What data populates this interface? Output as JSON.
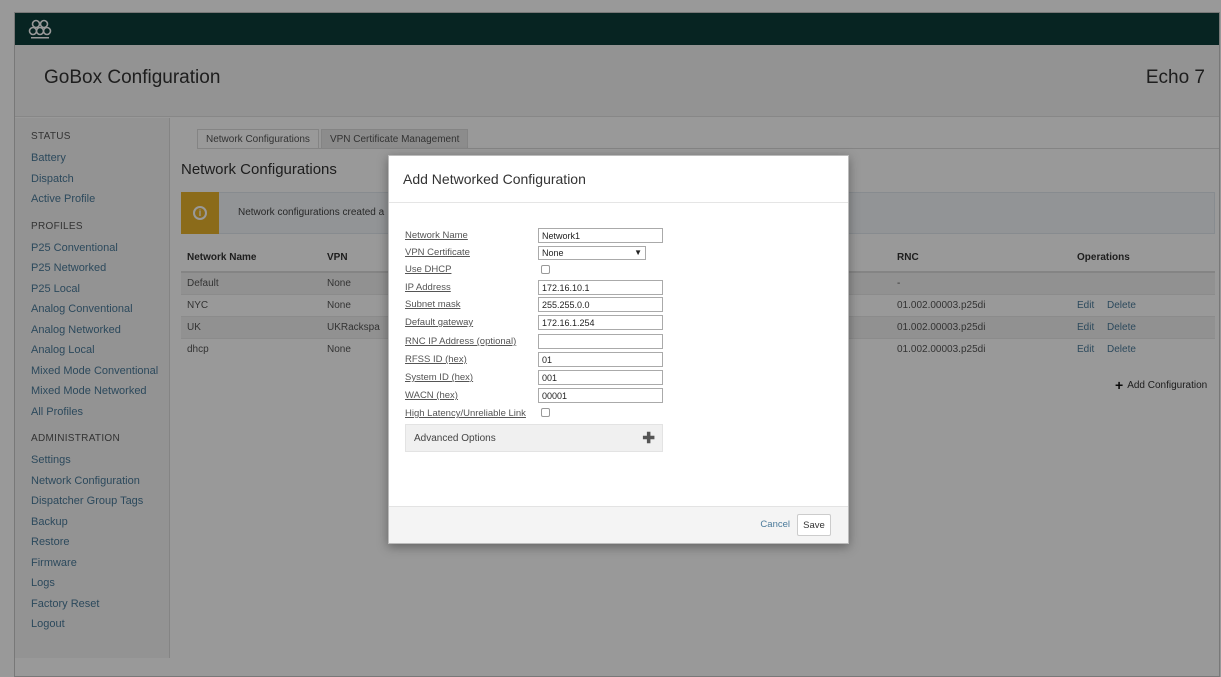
{
  "header": {
    "app_title": "GoBox Configuration",
    "device_name": "Echo 7"
  },
  "sidebar": {
    "sections": [
      {
        "heading": "Status",
        "items": [
          "Battery",
          "Dispatch",
          "Active Profile"
        ]
      },
      {
        "heading": "Profiles",
        "items": [
          "P25 Conventional",
          "P25 Networked",
          "P25 Local",
          "Analog Conventional",
          "Analog Networked",
          "Analog Local",
          "Mixed Mode Conventional",
          "Mixed Mode Networked",
          "All Profiles"
        ]
      },
      {
        "heading": "Administration",
        "items": [
          "Settings",
          "Network Configuration",
          "Dispatcher Group Tags",
          "Backup",
          "Restore",
          "Firmware",
          "Logs",
          "Factory Reset",
          "Logout"
        ]
      }
    ]
  },
  "tabs": [
    "Network Configurations",
    "VPN Certificate Management"
  ],
  "section_title": "Network Configurations",
  "info_text": "Network configurations created a",
  "table": {
    "columns": [
      "Network Name",
      "VPN",
      "RNC",
      "Operations"
    ],
    "rows": [
      {
        "name": "Default",
        "vpn": "None",
        "rnc": "-",
        "ops": []
      },
      {
        "name": "NYC",
        "vpn": "None",
        "rnc": "01.002.00003.p25di",
        "ops": [
          "Edit",
          "Delete"
        ]
      },
      {
        "name": "UK",
        "vpn": "UKRackspa",
        "rnc": "01.002.00003.p25di",
        "ops": [
          "Edit",
          "Delete"
        ]
      },
      {
        "name": "dhcp",
        "vpn": "None",
        "rnc": "01.002.00003.p25di",
        "ops": [
          "Edit",
          "Delete"
        ]
      }
    ]
  },
  "add_config_label": "Add Configuration",
  "modal": {
    "title": "Add Networked Configuration",
    "fields": {
      "network_name": {
        "label": "Network Name",
        "value": "Network1"
      },
      "vpn_certificate": {
        "label": "VPN Certificate",
        "value": "None"
      },
      "use_dhcp": {
        "label": "Use DHCP",
        "checked": false
      },
      "ip_address": {
        "label": "IP Address",
        "value": "172.16.10.1"
      },
      "subnet_mask": {
        "label": "Subnet mask",
        "value": "255.255.0.0"
      },
      "default_gateway": {
        "label": "Default gateway",
        "value": "172.16.1.254"
      },
      "rnc_ip": {
        "label": "RNC IP Address (optional)",
        "value": ""
      },
      "rfss_id": {
        "label": "RFSS ID (hex)",
        "value": "01"
      },
      "system_id": {
        "label": "System ID (hex)",
        "value": "001"
      },
      "wacn": {
        "label": "WACN (hex)",
        "value": "00001"
      },
      "high_latency": {
        "label": "High Latency/Unreliable Link",
        "checked": false
      }
    },
    "advanced_label": "Advanced Options",
    "cancel_label": "Cancel",
    "save_label": "Save"
  },
  "colors": {
    "topbar": "#0d3c3a",
    "link": "#4a7a9a",
    "info_icon": "#e8b32c"
  }
}
